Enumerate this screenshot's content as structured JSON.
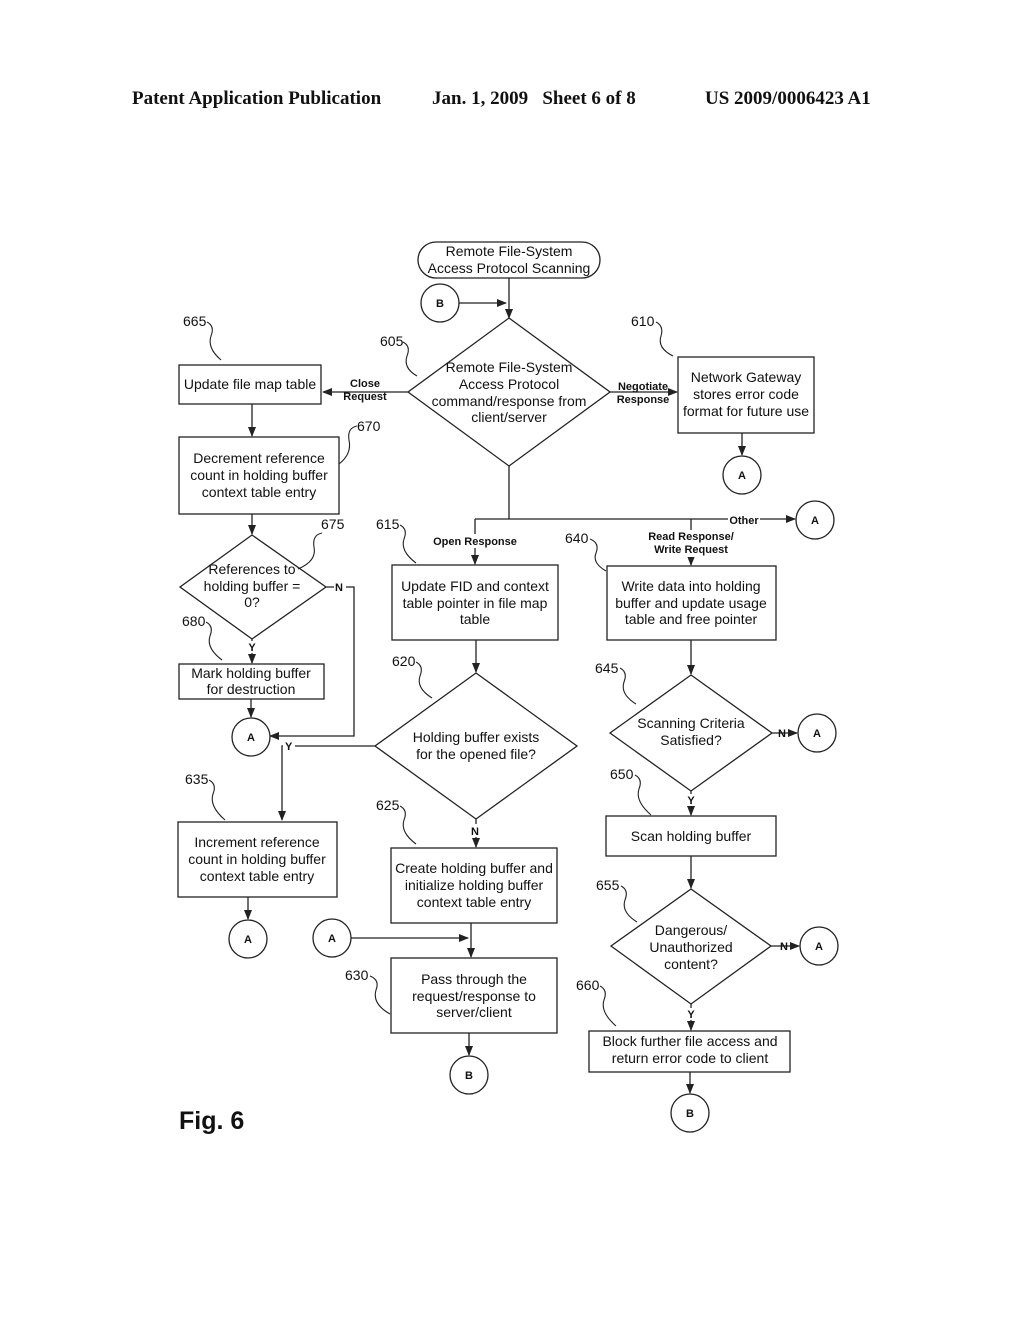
{
  "header": {
    "publication": "Patent Application Publication",
    "date_sheet": "Jan. 1, 2009   Sheet 6 of 8",
    "number": "US 2009/0006423 A1"
  },
  "figure_label": "Fig. 6",
  "start": {
    "lines": [
      "Remote File-System",
      "Access Protocol Scanning"
    ]
  },
  "connectors": {
    "a": "A",
    "b": "B"
  },
  "nodes": {
    "n605": {
      "ref": "605",
      "lines": [
        "Remote File-System",
        "Access Protocol",
        "command/response from",
        "client/server"
      ]
    },
    "n610": {
      "ref": "610",
      "lines": [
        "Network Gateway",
        "stores error code",
        "format for future use"
      ]
    },
    "n665": {
      "ref": "665",
      "lines": [
        "Update file map table"
      ]
    },
    "n670": {
      "ref": "670",
      "lines": [
        "Decrement reference",
        "count in holding buffer",
        "context table entry"
      ]
    },
    "n675": {
      "ref": "675",
      "lines": [
        "References to",
        "holding buffer =",
        "0?"
      ]
    },
    "n680": {
      "ref": "680",
      "lines": [
        "Mark holding buffer",
        "for destruction"
      ]
    },
    "n615": {
      "ref": "615",
      "lines": [
        "Update FID and context",
        "table pointer in file map",
        "table"
      ]
    },
    "n620": {
      "ref": "620",
      "lines": [
        "Holding buffer exists",
        "for the opened file?"
      ]
    },
    "n625": {
      "ref": "625",
      "lines": [
        "Create holding buffer and",
        "initialize holding buffer",
        "context table entry"
      ]
    },
    "n630": {
      "ref": "630",
      "lines": [
        "Pass through the",
        "request/response to",
        "server/client"
      ]
    },
    "n635": {
      "ref": "635",
      "lines": [
        "Increment reference",
        "count in holding buffer",
        "context table entry"
      ]
    },
    "n640": {
      "ref": "640",
      "lines": [
        "Write data into holding",
        "buffer and update usage",
        "table and free pointer"
      ]
    },
    "n645": {
      "ref": "645",
      "lines": [
        "Scanning Criteria",
        "Satisfied?"
      ]
    },
    "n650": {
      "ref": "650",
      "lines": [
        "Scan holding buffer"
      ]
    },
    "n655": {
      "ref": "655",
      "lines": [
        "Dangerous/",
        "Unauthorized",
        "content?"
      ]
    },
    "n660": {
      "ref": "660",
      "lines": [
        "Block further file access and",
        "return error code to client"
      ]
    }
  },
  "edge_labels": {
    "close": [
      "Close",
      "Request"
    ],
    "negotiate": [
      "Negotiate",
      "Response"
    ],
    "other": "Other",
    "open": "Open Response",
    "readwrite": [
      "Read Response/",
      "Write Request"
    ],
    "yes": "Y",
    "no": "N"
  }
}
